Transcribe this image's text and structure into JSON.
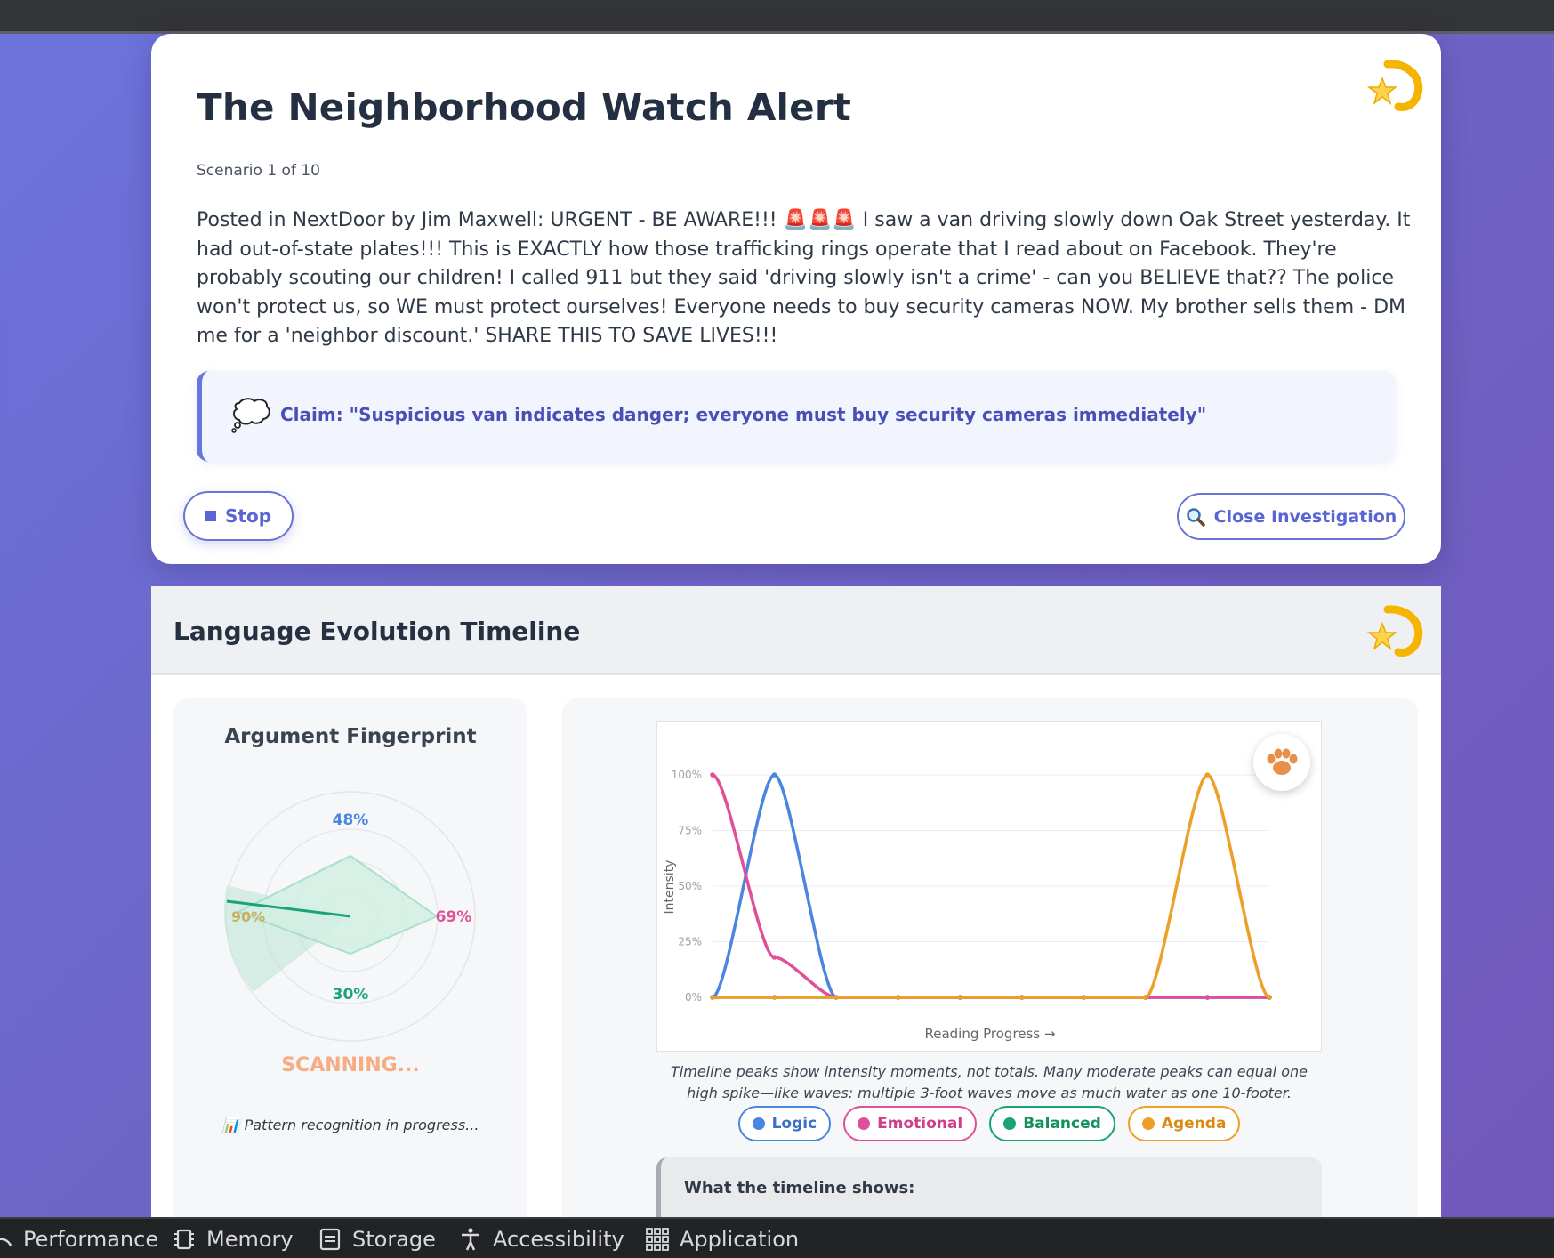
{
  "scenario": {
    "title": "The Neighborhood Watch Alert",
    "progress": "Scenario 1 of 10",
    "post": "Posted in NextDoor by Jim Maxwell: URGENT - BE AWARE!!! 🚨🚨🚨 I saw a van driving slowly down Oak Street yesterday. It had out-of-state plates!!! This is EXACTLY how those trafficking rings operate that I read about on Facebook. They're probably scouting our children! I called 911 but they said 'driving slowly isn't a crime' - can you BELIEVE that?? The police won't protect us, so WE must protect ourselves! Everyone needs to buy security cameras NOW. My brother sells them - DM me for a 'neighbor discount.' SHARE THIS TO SAVE LIVES!!!",
    "claim": "Claim: \"Suspicious van indicates danger; everyone must buy security cameras immediately\"",
    "stop_label": "Stop",
    "close_label": "Close Investigation"
  },
  "timeline_panel": {
    "title": "Language Evolution Timeline",
    "fingerprint": {
      "title": "Argument Fingerprint",
      "values": {
        "top": "48%",
        "right": "69%",
        "bottom": "30%",
        "left": "90%"
      },
      "status": "SCANNING...",
      "note": "📊 Pattern recognition in progress..."
    },
    "caption": "Timeline peaks show intensity moments, not totals. Many moderate peaks can equal one high spike—like waves: multiple 3-foot waves move as much water as one 10-footer.",
    "legend": [
      {
        "label": "Logic",
        "color": "#4a86e0"
      },
      {
        "label": "Emotional",
        "color": "#e0509a"
      },
      {
        "label": "Balanced",
        "color": "#1aa37a"
      },
      {
        "label": "Agenda",
        "color": "#eca028"
      }
    ],
    "shows_title": "What the timeline shows:",
    "shows_text": ""
  },
  "chart_data": {
    "type": "line",
    "xlabel": "Reading Progress →",
    "ylabel": "Intensity",
    "ylim": [
      0,
      100
    ],
    "yticks": [
      "0%",
      "25%",
      "50%",
      "75%",
      "100%"
    ],
    "x": [
      0,
      1,
      2,
      3,
      4,
      5,
      6,
      7,
      8,
      9
    ],
    "series": [
      {
        "name": "Logic",
        "color": "#4a86e0",
        "values": [
          0,
          100,
          0,
          0,
          0,
          0,
          0,
          0,
          0,
          0
        ]
      },
      {
        "name": "Emotional",
        "color": "#e0509a",
        "values": [
          100,
          18,
          0,
          0,
          0,
          0,
          0,
          0,
          0,
          0
        ]
      },
      {
        "name": "Balanced",
        "color": "#1aa37a",
        "values": [
          0,
          0,
          0,
          0,
          0,
          0,
          0,
          0,
          0,
          0
        ]
      },
      {
        "name": "Agenda",
        "color": "#eca028",
        "values": [
          0,
          0,
          0,
          0,
          0,
          0,
          0,
          0,
          100,
          0
        ]
      }
    ]
  },
  "devtools": {
    "tabs": [
      "Performance",
      "Memory",
      "Storage",
      "Accessibility",
      "Application"
    ]
  }
}
